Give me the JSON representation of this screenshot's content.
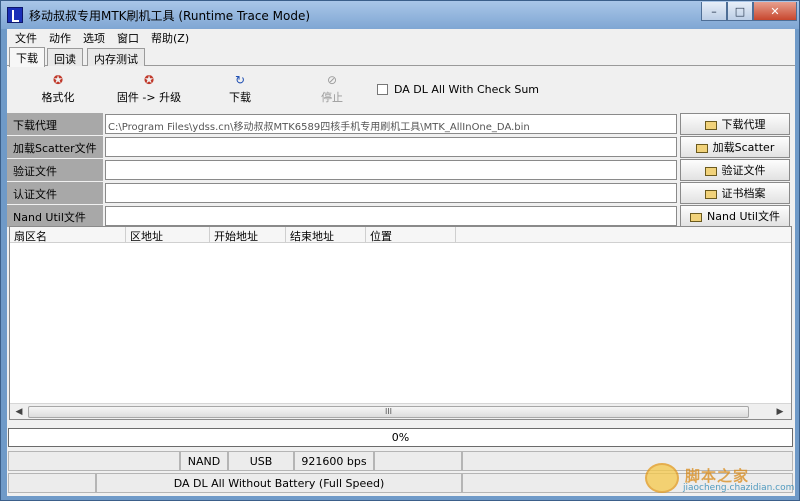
{
  "window": {
    "title": "移动叔叔专用MTK刷机工具 (Runtime Trace Mode)"
  },
  "titlebar_buttons": {
    "minimize": "–",
    "maximize": "□",
    "close": "✕"
  },
  "menu": [
    "文件",
    "动作",
    "选项",
    "窗口",
    "帮助(Z)"
  ],
  "tabs": [
    "下载",
    "回读",
    "内存测试"
  ],
  "toolbar": {
    "format": "格式化",
    "firmware_upgrade": "固件 -> 升级",
    "download": "下载",
    "stop": "停止",
    "checkbox_label": "DA DL All With Check Sum"
  },
  "rows": [
    {
      "label": "下载代理",
      "value": "C:\\Program Files\\ydss.cn\\移动叔叔MTK6589四核手机专用刷机工具\\MTK_AllInOne_DA.bin",
      "button": "下载代理"
    },
    {
      "label": "加载Scatter文件",
      "value": "",
      "button": "加载Scatter"
    },
    {
      "label": "验证文件",
      "value": "",
      "button": "验证文件"
    },
    {
      "label": "认证文件",
      "value": "",
      "button": "证书档案"
    },
    {
      "label": "Nand Util文件",
      "value": "",
      "button": "Nand Util文件"
    }
  ],
  "list": {
    "columns": [
      "扇区名",
      "区地址",
      "开始地址",
      "结束地址",
      "位置"
    ],
    "scroll_thumb": "III"
  },
  "progress": {
    "text": "0%",
    "value": 0
  },
  "status": {
    "nand": "NAND",
    "usb": "USB",
    "baud": "921600 bps",
    "mode": "DA DL All Without Battery (Full Speed)"
  },
  "watermark": {
    "text": "脚本之家",
    "site": "jiaocheng.chazidian.com"
  }
}
